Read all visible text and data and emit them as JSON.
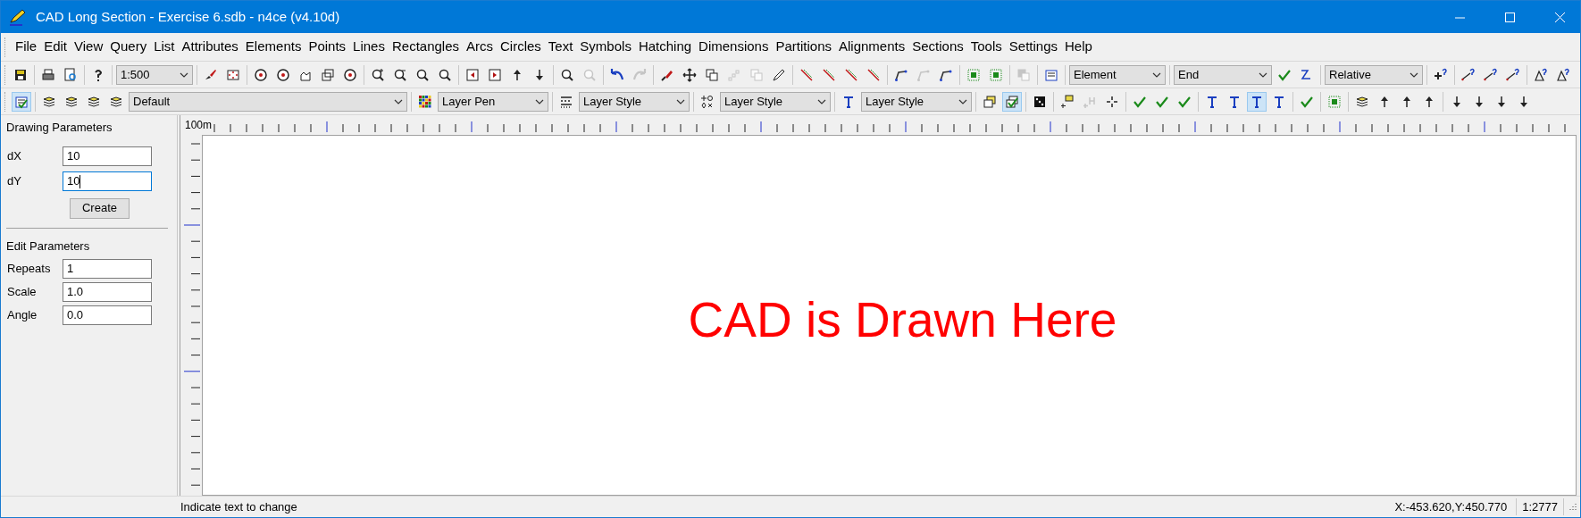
{
  "window": {
    "title": "CAD Long Section - Exercise 6.sdb - n4ce (v4.10d)"
  },
  "menu": [
    "File",
    "Edit",
    "View",
    "Query",
    "List",
    "Attributes",
    "Elements",
    "Points",
    "Lines",
    "Rectangles",
    "Arcs",
    "Circles",
    "Text",
    "Symbols",
    "Hatching",
    "Dimensions",
    "Partitions",
    "Alignments",
    "Sections",
    "Tools",
    "Settings",
    "Help"
  ],
  "toolbars": [
    [
      [
        {
          "kind": "button",
          "pressed": false,
          "disabled": false
        }
      ],
      [
        {
          "kind": "button",
          "pressed": false,
          "disabled": false
        },
        {
          "kind": "button",
          "pressed": false,
          "disabled": false
        }
      ],
      [
        {
          "kind": "button",
          "pressed": false,
          "disabled": false
        }
      ],
      [
        {
          "kind": "dropdown",
          "value": "1:500"
        }
      ],
      [
        {
          "kind": "button",
          "pressed": false,
          "disabled": false
        },
        {
          "kind": "button",
          "pressed": false,
          "disabled": false
        }
      ],
      [
        {
          "kind": "button",
          "pressed": false,
          "disabled": false
        },
        {
          "kind": "button",
          "pressed": false,
          "disabled": false
        },
        {
          "kind": "button",
          "pressed": false,
          "disabled": false
        },
        {
          "kind": "button",
          "pressed": false,
          "disabled": false
        },
        {
          "kind": "button",
          "pressed": false,
          "disabled": false
        }
      ],
      [
        {
          "kind": "button",
          "pressed": false,
          "disabled": false
        },
        {
          "kind": "button",
          "pressed": false,
          "disabled": false
        },
        {
          "kind": "button",
          "pressed": false,
          "disabled": false
        },
        {
          "kind": "button",
          "pressed": false,
          "disabled": false
        }
      ],
      [
        {
          "kind": "button",
          "pressed": false,
          "disabled": false
        },
        {
          "kind": "button",
          "pressed": false,
          "disabled": false
        },
        {
          "kind": "button",
          "pressed": false,
          "disabled": false
        },
        {
          "kind": "button",
          "pressed": false,
          "disabled": false
        }
      ],
      [
        {
          "kind": "button",
          "pressed": false,
          "disabled": false
        },
        {
          "kind": "button",
          "pressed": false,
          "disabled": true
        }
      ],
      [
        {
          "kind": "button",
          "pressed": false,
          "disabled": false
        },
        {
          "kind": "button",
          "pressed": false,
          "disabled": true
        }
      ],
      [
        {
          "kind": "button",
          "pressed": false,
          "disabled": false
        },
        {
          "kind": "button",
          "pressed": false,
          "disabled": false
        },
        {
          "kind": "button",
          "pressed": false,
          "disabled": false
        },
        {
          "kind": "button",
          "pressed": false,
          "disabled": true
        },
        {
          "kind": "button",
          "pressed": false,
          "disabled": true
        },
        {
          "kind": "button",
          "pressed": false,
          "disabled": false
        }
      ],
      [
        {
          "kind": "button",
          "pressed": false,
          "disabled": false
        },
        {
          "kind": "button",
          "pressed": false,
          "disabled": false
        },
        {
          "kind": "button",
          "pressed": false,
          "disabled": false
        },
        {
          "kind": "button",
          "pressed": false,
          "disabled": false
        }
      ],
      [
        {
          "kind": "button",
          "pressed": false,
          "disabled": false
        },
        {
          "kind": "button",
          "pressed": false,
          "disabled": true
        },
        {
          "kind": "button",
          "pressed": false,
          "disabled": false
        }
      ],
      [
        {
          "kind": "button",
          "pressed": false,
          "disabled": false
        },
        {
          "kind": "button",
          "pressed": false,
          "disabled": false
        }
      ],
      [
        {
          "kind": "button",
          "pressed": false,
          "disabled": true
        }
      ],
      [
        {
          "kind": "button",
          "pressed": false,
          "disabled": false
        }
      ],
      [
        {
          "kind": "dropdown",
          "value": "Element"
        }
      ],
      [
        {
          "kind": "dropdown",
          "value": "End"
        },
        {
          "kind": "button",
          "pressed": false,
          "disabled": false
        },
        {
          "kind": "button",
          "pressed": false,
          "disabled": false
        }
      ],
      [
        {
          "kind": "dropdown",
          "value": "Relative"
        }
      ],
      [
        {
          "kind": "button",
          "pressed": false,
          "disabled": false
        }
      ],
      [
        {
          "kind": "button",
          "pressed": false,
          "disabled": false
        },
        {
          "kind": "button",
          "pressed": false,
          "disabled": false
        },
        {
          "kind": "button",
          "pressed": false,
          "disabled": false
        }
      ],
      [
        {
          "kind": "button",
          "pressed": false,
          "disabled": false
        },
        {
          "kind": "button",
          "pressed": false,
          "disabled": false
        }
      ]
    ],
    [
      [
        {
          "kind": "button",
          "pressed": true,
          "disabled": false
        }
      ],
      [
        {
          "kind": "button",
          "pressed": false,
          "disabled": false
        },
        {
          "kind": "button",
          "pressed": false,
          "disabled": false
        },
        {
          "kind": "button",
          "pressed": false,
          "disabled": false
        },
        {
          "kind": "button",
          "pressed": false,
          "disabled": false
        },
        {
          "kind": "dropdown",
          "value": "Default"
        }
      ],
      [
        {
          "kind": "button",
          "pressed": false,
          "disabled": false
        },
        {
          "kind": "dropdown",
          "value": "Layer Pen"
        }
      ],
      [
        {
          "kind": "button",
          "pressed": false,
          "disabled": false
        },
        {
          "kind": "dropdown",
          "value": "Layer Style"
        }
      ],
      [
        {
          "kind": "button",
          "pressed": false,
          "disabled": false
        },
        {
          "kind": "dropdown",
          "value": "Layer Style"
        }
      ],
      [
        {
          "kind": "button",
          "pressed": false,
          "disabled": false
        },
        {
          "kind": "dropdown",
          "value": "Layer Style"
        }
      ],
      [
        {
          "kind": "button",
          "pressed": false,
          "disabled": false
        },
        {
          "kind": "button",
          "pressed": true,
          "disabled": false
        }
      ],
      [
        {
          "kind": "button",
          "pressed": false,
          "disabled": false
        }
      ],
      [
        {
          "kind": "button",
          "pressed": false,
          "disabled": false
        },
        {
          "kind": "button",
          "pressed": false,
          "disabled": true
        },
        {
          "kind": "button",
          "pressed": false,
          "disabled": false
        }
      ],
      [
        {
          "kind": "button",
          "pressed": false,
          "disabled": false
        },
        {
          "kind": "button",
          "pressed": false,
          "disabled": false
        },
        {
          "kind": "button",
          "pressed": false,
          "disabled": false
        }
      ],
      [
        {
          "kind": "button",
          "pressed": false,
          "disabled": false
        },
        {
          "kind": "button",
          "pressed": false,
          "disabled": false
        },
        {
          "kind": "button",
          "pressed": true,
          "disabled": false
        },
        {
          "kind": "button",
          "pressed": false,
          "disabled": false
        }
      ],
      [
        {
          "kind": "button",
          "pressed": false,
          "disabled": false
        }
      ],
      [
        {
          "kind": "button",
          "pressed": false,
          "disabled": false
        }
      ],
      [
        {
          "kind": "button",
          "pressed": false,
          "disabled": false
        },
        {
          "kind": "button",
          "pressed": false,
          "disabled": false
        },
        {
          "kind": "button",
          "pressed": false,
          "disabled": false
        },
        {
          "kind": "button",
          "pressed": false,
          "disabled": false
        }
      ],
      [
        {
          "kind": "button",
          "pressed": false,
          "disabled": false
        },
        {
          "kind": "button",
          "pressed": false,
          "disabled": false
        },
        {
          "kind": "button",
          "pressed": false,
          "disabled": false
        },
        {
          "kind": "button",
          "pressed": false,
          "disabled": false
        }
      ]
    ]
  ],
  "panel": {
    "drawing_title": "Drawing Parameters",
    "drawing_fields": [
      {
        "label": "dX",
        "value": "10",
        "focused": false
      },
      {
        "label": "dY",
        "value": "10",
        "focused": true
      }
    ],
    "create_button": "Create",
    "edit_title": "Edit Parameters",
    "edit_fields": [
      {
        "label": "Repeats",
        "value": "1",
        "focused": false
      },
      {
        "label": "Scale",
        "value": "1.0",
        "focused": false
      },
      {
        "label": "Angle",
        "value": "0.0",
        "focused": false
      }
    ]
  },
  "ruler": {
    "label": "100m"
  },
  "canvas": {
    "text": "CAD is Drawn Here"
  },
  "status_bar": {
    "message": "Indicate text to change",
    "coordinates": "X:-453.620,Y:450.770",
    "scale": "1:2777"
  }
}
